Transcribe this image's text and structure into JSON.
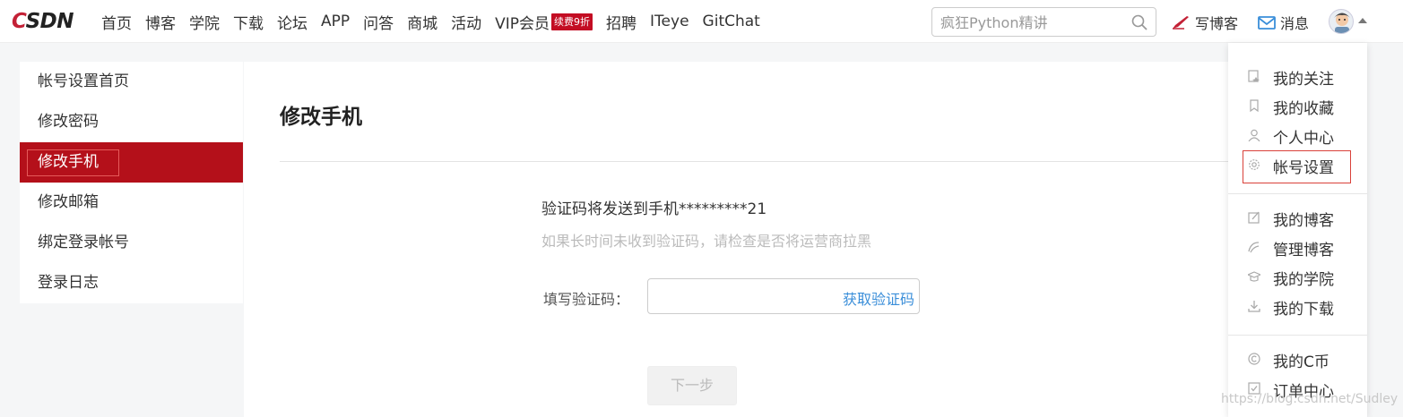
{
  "header": {
    "logo_text": "CSDN",
    "nav": [
      {
        "label": "首页"
      },
      {
        "label": "博客"
      },
      {
        "label": "学院"
      },
      {
        "label": "下载"
      },
      {
        "label": "论坛"
      },
      {
        "label": "APP"
      },
      {
        "label": "问答"
      },
      {
        "label": "商城"
      },
      {
        "label": "活动"
      },
      {
        "label": "VIP会员",
        "badge": "续费9折"
      },
      {
        "label": "招聘"
      },
      {
        "label": "ITeye"
      },
      {
        "label": "GitChat"
      }
    ],
    "search_placeholder": "疯狂Python精讲",
    "write_label": "写博客",
    "message_label": "消息",
    "brand_color": "#c32136",
    "badge_color": "#c30d23"
  },
  "sidebar": {
    "items": [
      {
        "label": "帐号设置首页"
      },
      {
        "label": "修改密码"
      },
      {
        "label": "修改手机",
        "active": true
      },
      {
        "label": "修改邮箱"
      },
      {
        "label": "绑定登录帐号"
      },
      {
        "label": "登录日志"
      }
    ],
    "active_color": "#b4101a"
  },
  "main": {
    "title": "修改手机",
    "sent_text": "验证码将发送到手机*********21",
    "hint_text": "如果长时间未收到验证码，请检查是否将运营商拉黑",
    "code_label": "填写验证码：",
    "get_code_label": "获取验证码",
    "next_label": "下一步",
    "link_color": "#3a8ed9"
  },
  "dropdown": {
    "items": [
      {
        "label": "我的关注",
        "icon": "follow-icon"
      },
      {
        "label": "我的收藏",
        "icon": "bookmark-icon"
      },
      {
        "label": "个人中心",
        "icon": "user-icon"
      },
      {
        "label": "帐号设置",
        "icon": "gear-icon"
      },
      {
        "label": "我的博客",
        "icon": "edit-icon"
      },
      {
        "label": "管理博客",
        "icon": "manage-icon"
      },
      {
        "label": "我的学院",
        "icon": "graduation-cap-icon"
      },
      {
        "label": "我的下载",
        "icon": "download-icon"
      },
      {
        "label": "我的C币",
        "icon": "coin-icon"
      },
      {
        "label": "订单中心",
        "icon": "order-icon"
      }
    ]
  },
  "watermark": "https://blog.csdn.net/Sudley"
}
